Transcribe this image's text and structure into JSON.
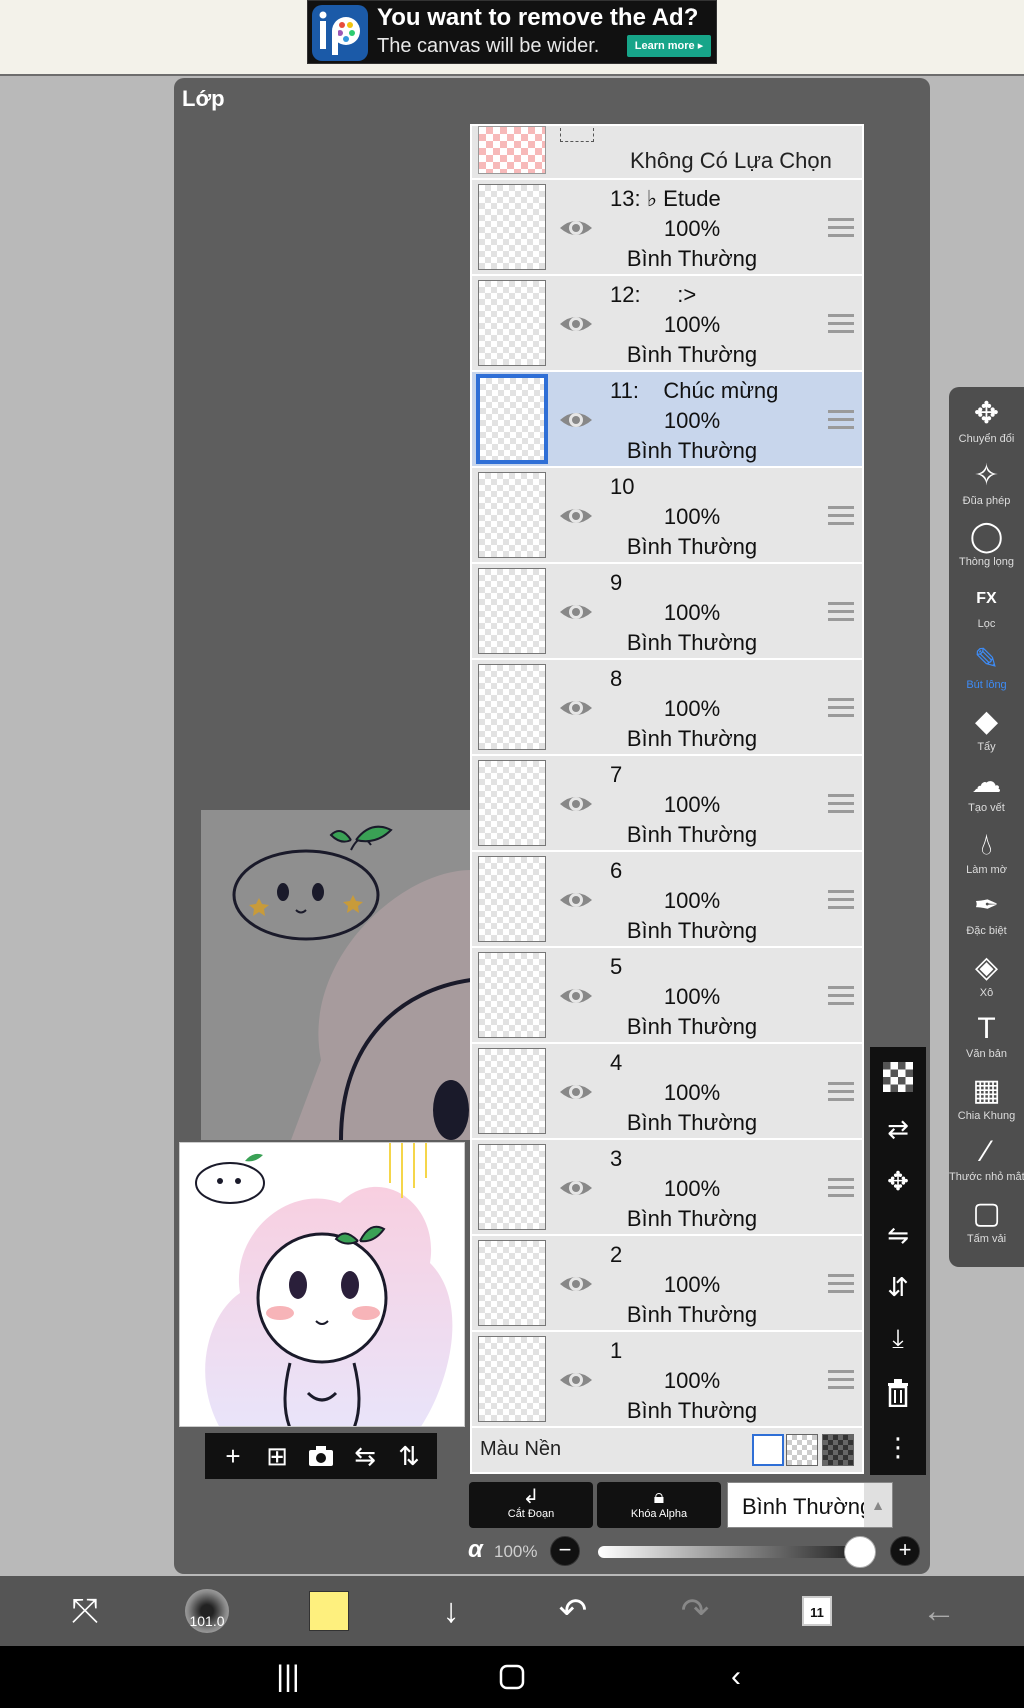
{
  "ad": {
    "title": "You want to remove the Ad?",
    "subtitle": "The canvas will be wider.",
    "button": "Learn more ▸"
  },
  "panel": {
    "title": "Lớp"
  },
  "layers_header": {
    "label": "Không Có Lựa Chọn"
  },
  "layers": [
    {
      "name": "13: ♭ Etude",
      "opacity": "100%",
      "blend": "Bình Thường",
      "selected": false
    },
    {
      "name": "12:      :>",
      "opacity": "100%",
      "blend": "Bình Thường",
      "selected": false
    },
    {
      "name": "11:    Chúc mừng",
      "opacity": "100%",
      "blend": "Bình Thường",
      "selected": true
    },
    {
      "name": "10",
      "opacity": "100%",
      "blend": "Bình Thường",
      "selected": false
    },
    {
      "name": "9",
      "opacity": "100%",
      "blend": "Bình Thường",
      "selected": false
    },
    {
      "name": "8",
      "opacity": "100%",
      "blend": "Bình Thường",
      "selected": false
    },
    {
      "name": "7",
      "opacity": "100%",
      "blend": "Bình Thường",
      "selected": false
    },
    {
      "name": "6",
      "opacity": "100%",
      "blend": "Bình Thường",
      "selected": false
    },
    {
      "name": "5",
      "opacity": "100%",
      "blend": "Bình Thường",
      "selected": false
    },
    {
      "name": "4",
      "opacity": "100%",
      "blend": "Bình Thường",
      "selected": false
    },
    {
      "name": "3",
      "opacity": "100%",
      "blend": "Bình Thường",
      "selected": false
    },
    {
      "name": "2",
      "opacity": "100%",
      "blend": "Bình Thường",
      "selected": false
    },
    {
      "name": "1",
      "opacity": "100%",
      "blend": "Bình Thường",
      "selected": false
    }
  ],
  "background": {
    "label": "Màu Nền"
  },
  "controls": {
    "clip_label": "Cắt Đoạn",
    "alpha_lock_label": "Khóa Alpha",
    "blend_mode": "Bình Thường",
    "alpha_symbol": "α",
    "opacity": "100%"
  },
  "tools": [
    {
      "label": "Chuyển đổi",
      "icon": "move-icon",
      "active": false
    },
    {
      "label": "Đũa phép",
      "icon": "magic-wand-icon",
      "active": false
    },
    {
      "label": "Thòng lọng",
      "icon": "lasso-icon",
      "active": false
    },
    {
      "label": "Lọc",
      "icon": "fx-icon",
      "active": false
    },
    {
      "label": "Bút lông",
      "icon": "brush-icon",
      "active": true
    },
    {
      "label": "Tẩy",
      "icon": "eraser-icon",
      "active": false
    },
    {
      "label": "Tạo vết",
      "icon": "smudge-icon",
      "active": false
    },
    {
      "label": "Làm mờ",
      "icon": "blur-icon",
      "active": false
    },
    {
      "label": "Đặc biệt",
      "icon": "special-pen-icon",
      "active": false
    },
    {
      "label": "Xô",
      "icon": "bucket-icon",
      "active": false
    },
    {
      "label": "Văn bản",
      "icon": "text-icon",
      "active": false
    },
    {
      "label": "Chia Khung",
      "icon": "frame-divider-icon",
      "active": false
    },
    {
      "label": "Thước nhỏ mắt",
      "icon": "eyedropper-icon",
      "active": false
    },
    {
      "label": "Tấm vải",
      "icon": "canvas-icon",
      "active": false
    }
  ],
  "bottom": {
    "brush_size": "101.0",
    "color": "#fef07e",
    "layer_count": "11"
  }
}
